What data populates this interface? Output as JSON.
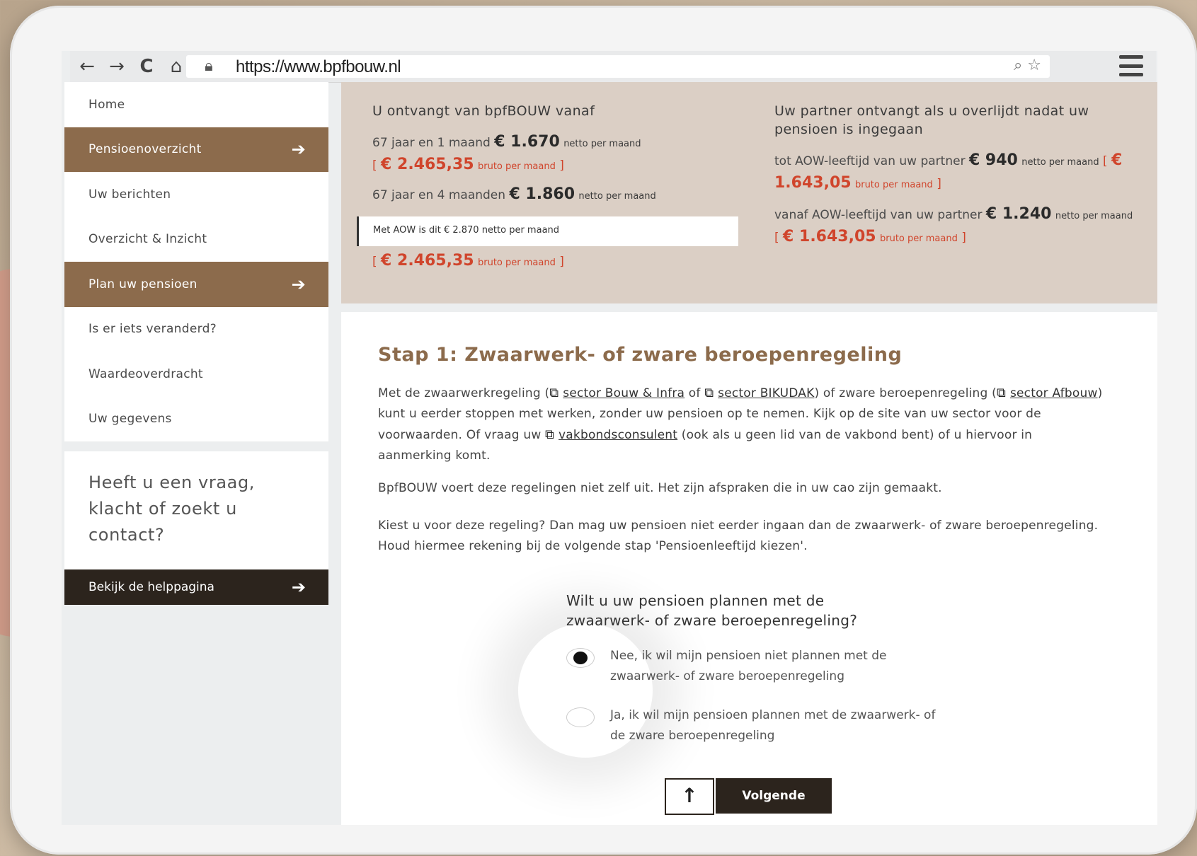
{
  "browser": {
    "url": "https://www.bpfbouw.nl",
    "nav_icons": [
      "back-icon",
      "forward-icon",
      "reload-icon",
      "home-icon"
    ]
  },
  "sidebar": {
    "items": [
      {
        "label": "Home",
        "active": false
      },
      {
        "label": "Pensioenoverzicht",
        "active": true
      },
      {
        "label": "Uw berichten",
        "active": false
      },
      {
        "label": "Overzicht & Inzicht",
        "active": false
      },
      {
        "label": "Plan uw pensioen",
        "active": true
      },
      {
        "label": "Is er iets veranderd?",
        "active": false
      },
      {
        "label": "Waardeoverdracht",
        "active": false
      },
      {
        "label": "Uw gegevens",
        "active": false
      }
    ],
    "help_question": "Heeft u een vraag, klacht of zoekt u contact?",
    "help_button": "Bekijk de helppagina"
  },
  "summary": {
    "left": {
      "heading": "U ontvangt van bpfBOUW vanaf",
      "line1_prefix": "67 jaar en 1 maand",
      "line1_amount": "€ 1.670",
      "line1_suffix": "netto per maand",
      "line1_gross": "€ 2.465,35",
      "line1_gross_suffix": "bruto per maand",
      "line2_prefix": "67 jaar en 4 maanden",
      "line2_amount": "€ 1.860",
      "line2_suffix": "netto per maand",
      "aow_note": "Met AOW is dit  € 2.870 netto per maand",
      "line2_gross": "€ 2.465,35",
      "line2_gross_suffix": "bruto per maand"
    },
    "right": {
      "heading": "Uw partner ontvangt als u overlijdt nadat uw pensioen is ingegaan",
      "line1_prefix": "tot AOW-leeftijd van uw partner",
      "line1_amount": "€ 940",
      "line1_suffix": "netto per maand",
      "line1_gross": "€ 1.643,05",
      "line1_gross_suffix": "bruto per maand",
      "line2_prefix": "vanaf AOW-leeftijd van uw partner",
      "line2_amount": "€ 1.240",
      "line2_suffix": "netto per maand",
      "line2_gross": "€ 1.643,05",
      "line2_gross_suffix": "bruto per maand"
    }
  },
  "content": {
    "title": "Stap 1: Zwaarwerk- of zware beroepenregeling",
    "p1_a": "Met de zwaarwerkregeling (",
    "link1": "sector Bouw & Infra",
    "p1_b": " of ",
    "link2": "sector BIKUDAK",
    "p1_c": ") of zware beroepenregeling (",
    "link3": "sector Afbouw",
    "p1_d": ") kunt u eerder stoppen met werken, zonder uw pensioen op te nemen. Kijk op de site van uw sector voor de voorwaarden. Of vraag uw ",
    "link4": "vakbondsconsulent",
    "p1_e": " (ook als u geen lid van de vakbond bent) of u hiervoor in aanmerking komt.",
    "p2": "BpfBOUW voert deze regelingen niet zelf uit. Het zijn afspraken die in uw cao zijn gemaakt.",
    "p3": "Kiest u voor deze regeling? Dan mag uw pensioen niet eerder ingaan dan de zwaarwerk- of zware beroepenregeling. Houd hiermee rekening bij de volgende stap 'Pensioenleeftijd kiezen'.",
    "question": "Wilt u uw pensioen plannen met de zwaarwerk- of zware beroepenregeling?",
    "option_no": "Nee, ik wil mijn pensioen niet plannen met de zwaarwerk- of zware beroepenregeling",
    "option_yes": "Ja, ik wil mijn pensioen plannen met de zwaarwerk- of de zware beroepenregeling",
    "selected": "no",
    "next_button": "Volgende"
  },
  "colors": {
    "brown": "#8c6b4c",
    "dark": "#2c241d",
    "beige": "#dbcfc5",
    "red": "#d0452c"
  }
}
